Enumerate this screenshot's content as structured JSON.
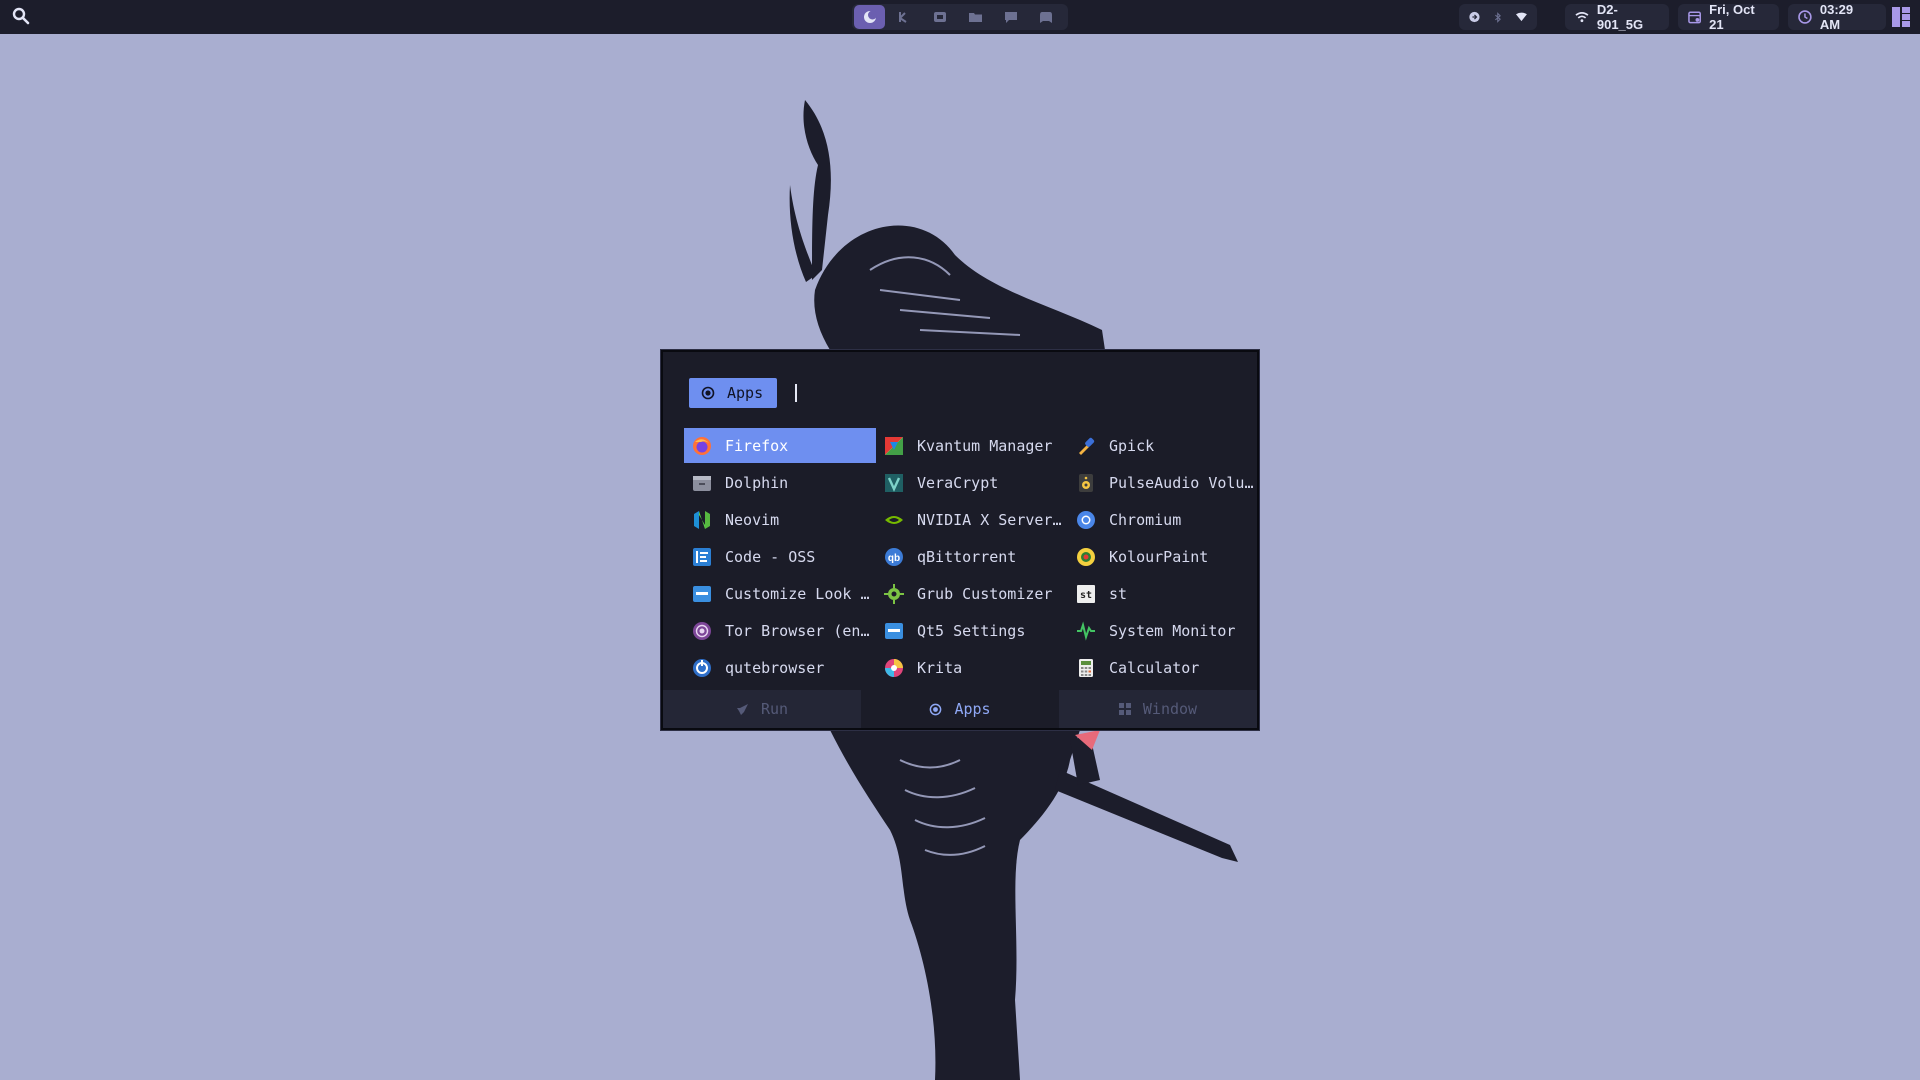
{
  "colors": {
    "desktop": "#a9aed0",
    "bar": "#1c1d2b",
    "accent": "#6e8ff0",
    "launcher_bg": "#1b1c28",
    "workspace_active": "#6b5fb0"
  },
  "topbar": {
    "search_icon": "search-icon",
    "workspaces": [
      {
        "icon": "arch-moon-icon",
        "active": true
      },
      {
        "icon": "terminal-icon",
        "active": false
      },
      {
        "icon": "code-icon",
        "active": false
      },
      {
        "icon": "folder-icon",
        "active": false
      },
      {
        "icon": "chat-icon",
        "active": false
      },
      {
        "icon": "game-icon",
        "active": false
      }
    ],
    "tray_icons": [
      "arrow-circle-icon",
      "bluetooth-icon",
      "wifi-icon"
    ],
    "network": {
      "icon": "wifi-icon",
      "label": "D2-901_5G"
    },
    "date": {
      "icon": "calendar-icon",
      "label": "Fri, Oct 21"
    },
    "time": {
      "icon": "clock-icon",
      "label": "03:29 AM"
    },
    "layout_icon": "layout-icon"
  },
  "launcher": {
    "mode_label": "Apps",
    "query": "",
    "apps": [
      {
        "label": "Firefox",
        "icon": "firefox-icon",
        "selected": true
      },
      {
        "label": "Kvantum Manager",
        "icon": "kvantum-icon"
      },
      {
        "label": "Gpick",
        "icon": "gpick-icon"
      },
      {
        "label": "Dolphin",
        "icon": "dolphin-icon"
      },
      {
        "label": "VeraCrypt",
        "icon": "veracrypt-icon"
      },
      {
        "label": "PulseAudio Volu…",
        "icon": "pulseaudio-icon"
      },
      {
        "label": "Neovim",
        "icon": "neovim-icon"
      },
      {
        "label": "NVIDIA X Server…",
        "icon": "nvidia-icon"
      },
      {
        "label": "Chromium",
        "icon": "chromium-icon"
      },
      {
        "label": "Code - OSS",
        "icon": "code-oss-icon"
      },
      {
        "label": "qBittorrent",
        "icon": "qbittorrent-icon"
      },
      {
        "label": "KolourPaint",
        "icon": "kolourpaint-icon"
      },
      {
        "label": "Customize Look …",
        "icon": "customize-look-icon"
      },
      {
        "label": "Grub Customizer",
        "icon": "grub-icon"
      },
      {
        "label": "st",
        "icon": "st-terminal-icon"
      },
      {
        "label": "Tor Browser (en…",
        "icon": "tor-icon"
      },
      {
        "label": "Qt5 Settings",
        "icon": "qt5-icon"
      },
      {
        "label": "System Monitor",
        "icon": "system-monitor-icon"
      },
      {
        "label": "qutebrowser",
        "icon": "qutebrowser-icon"
      },
      {
        "label": "Krita",
        "icon": "krita-icon"
      },
      {
        "label": "Calculator",
        "icon": "calculator-icon"
      }
    ],
    "modes": [
      {
        "label": "Run",
        "icon": "rocket-icon",
        "active": false
      },
      {
        "label": "Apps",
        "icon": "apps-icon",
        "active": true
      },
      {
        "label": "Window",
        "icon": "window-icon",
        "active": false
      }
    ]
  }
}
